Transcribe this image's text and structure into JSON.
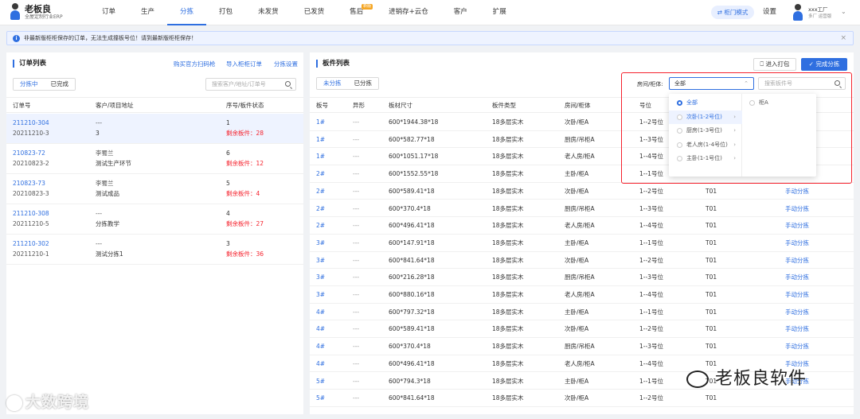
{
  "app": {
    "logo_title": "老板良",
    "logo_subtitle": "全屋定制行业ERP"
  },
  "nav": {
    "items": [
      {
        "label": "订单",
        "active": false,
        "badge": ""
      },
      {
        "label": "生产",
        "active": false,
        "badge": ""
      },
      {
        "label": "分拣",
        "active": true,
        "badge": ""
      },
      {
        "label": "打包",
        "active": false,
        "badge": ""
      },
      {
        "label": "未发货",
        "active": false,
        "badge": ""
      },
      {
        "label": "已发货",
        "active": false,
        "badge": ""
      },
      {
        "label": "售后",
        "active": false,
        "badge": "新版"
      },
      {
        "label": "进销存+云仓",
        "active": false,
        "badge": ""
      },
      {
        "label": "客户",
        "active": false,
        "badge": ""
      },
      {
        "label": "扩展",
        "active": false,
        "badge": ""
      }
    ],
    "cabinet_mode": "⇄ 柜门模式",
    "settings": "设置",
    "user_name": "xxx工厂",
    "user_role": "多厂 运营版"
  },
  "notice": {
    "text": "非最新版柜柜保存的订单，无法生成撞板号位！请到最新版柜柜保存！"
  },
  "order_panel": {
    "title": "订单列表",
    "links": [
      "购买官方扫码枪",
      "导入柜柜订单",
      "分拣设置"
    ],
    "tabs": [
      "分拣中",
      "已完成"
    ],
    "search_placeholder": "搜索客户/地址/订单号",
    "columns": [
      "订单号",
      "客户/项目地址",
      "序号/板件状态"
    ],
    "rows": [
      {
        "order_no": "211210-304",
        "order_sub": "20211210-3",
        "customer": "---",
        "address": "3",
        "seq": "1",
        "remain": "剩余板件：28",
        "selected": true
      },
      {
        "order_no": "210823-72",
        "order_sub": "20210823-2",
        "customer": "李蜀兰",
        "address": "测试生产环节",
        "seq": "6",
        "remain": "剩余板件：12",
        "selected": false
      },
      {
        "order_no": "210823-73",
        "order_sub": "20210823-3",
        "customer": "李蜀兰",
        "address": "测试成品",
        "seq": "5",
        "remain": "剩余板件：4",
        "selected": false
      },
      {
        "order_no": "211210-308",
        "order_sub": "20211210-5",
        "customer": "---",
        "address": "分拣教学",
        "seq": "4",
        "remain": "剩余板件：27",
        "selected": false
      },
      {
        "order_no": "211210-302",
        "order_sub": "20211210-1",
        "customer": "---",
        "address": "测试分拣1",
        "seq": "3",
        "remain": "剩余板件：36",
        "selected": false
      }
    ]
  },
  "board_panel": {
    "title": "板件列表",
    "enter_pack": "进入打包",
    "finish_sort": "完成分拣",
    "tabs": [
      "未分拣",
      "已分拣"
    ],
    "filter_label": "房间/柜体:",
    "filter_value": "全部",
    "search_placeholder": "搜索板件号",
    "columns": [
      "板号",
      "异形",
      "板材尺寸",
      "板件类型",
      "房间/柜体",
      "号位",
      "",
      ""
    ],
    "dropdown": {
      "col1": [
        {
          "label": "全部",
          "selected": true,
          "has_children": false
        },
        {
          "label": "次卧(1-2号位)",
          "selected": false,
          "has_children": true
        },
        {
          "label": "厨房(1-3号位)",
          "selected": false,
          "has_children": true
        },
        {
          "label": "老人房(1-4号位)",
          "selected": false,
          "has_children": true
        },
        {
          "label": "主卧(1-1号位)",
          "selected": false,
          "has_children": true
        }
      ],
      "col2": [
        {
          "label": "柜A"
        }
      ]
    },
    "rows": [
      {
        "no": "1#",
        "shape": "---",
        "size": "600*1944.38*18",
        "type": "18多层实木",
        "room": "次卧/柜A",
        "pos": "1--2号位",
        "code": "",
        "action": ""
      },
      {
        "no": "1#",
        "shape": "---",
        "size": "600*582.77*18",
        "type": "18多层实木",
        "room": "厨房/吊柜A",
        "pos": "1--3号位",
        "code": "",
        "action": ""
      },
      {
        "no": "1#",
        "shape": "---",
        "size": "600*1051.17*18",
        "type": "18多层实木",
        "room": "老人房/柜A",
        "pos": "1--4号位",
        "code": "",
        "action": ""
      },
      {
        "no": "2#",
        "shape": "---",
        "size": "600*1552.55*18",
        "type": "18多层实木",
        "room": "主卧/柜A",
        "pos": "1--1号位",
        "code": "",
        "action": ""
      },
      {
        "no": "2#",
        "shape": "---",
        "size": "600*589.41*18",
        "type": "18多层实木",
        "room": "次卧/柜A",
        "pos": "1--2号位",
        "code": "T01",
        "action": "手动分拣"
      },
      {
        "no": "2#",
        "shape": "---",
        "size": "600*370.4*18",
        "type": "18多层实木",
        "room": "厨房/吊柜A",
        "pos": "1--3号位",
        "code": "T01",
        "action": "手动分拣"
      },
      {
        "no": "2#",
        "shape": "---",
        "size": "600*496.41*18",
        "type": "18多层实木",
        "room": "老人房/柜A",
        "pos": "1--4号位",
        "code": "T01",
        "action": "手动分拣"
      },
      {
        "no": "3#",
        "shape": "---",
        "size": "600*147.91*18",
        "type": "18多层实木",
        "room": "主卧/柜A",
        "pos": "1--1号位",
        "code": "T01",
        "action": "手动分拣"
      },
      {
        "no": "3#",
        "shape": "---",
        "size": "600*841.64*18",
        "type": "18多层实木",
        "room": "次卧/柜A",
        "pos": "1--2号位",
        "code": "T01",
        "action": "手动分拣"
      },
      {
        "no": "3#",
        "shape": "---",
        "size": "600*216.28*18",
        "type": "18多层实木",
        "room": "厨房/吊柜A",
        "pos": "1--3号位",
        "code": "T01",
        "action": "手动分拣"
      },
      {
        "no": "3#",
        "shape": "---",
        "size": "600*880.16*18",
        "type": "18多层实木",
        "room": "老人房/柜A",
        "pos": "1--4号位",
        "code": "T01",
        "action": "手动分拣"
      },
      {
        "no": "4#",
        "shape": "---",
        "size": "600*797.32*18",
        "type": "18多层实木",
        "room": "主卧/柜A",
        "pos": "1--1号位",
        "code": "T01",
        "action": "手动分拣"
      },
      {
        "no": "4#",
        "shape": "---",
        "size": "600*589.41*18",
        "type": "18多层实木",
        "room": "次卧/柜A",
        "pos": "1--2号位",
        "code": "T01",
        "action": "手动分拣"
      },
      {
        "no": "4#",
        "shape": "---",
        "size": "600*370.4*18",
        "type": "18多层实木",
        "room": "厨房/吊柜A",
        "pos": "1--3号位",
        "code": "T01",
        "action": "手动分拣"
      },
      {
        "no": "4#",
        "shape": "---",
        "size": "600*496.41*18",
        "type": "18多层实木",
        "room": "老人房/柜A",
        "pos": "1--4号位",
        "code": "T01",
        "action": "手动分拣"
      },
      {
        "no": "5#",
        "shape": "---",
        "size": "600*794.3*18",
        "type": "18多层实木",
        "room": "主卧/柜A",
        "pos": "1--1号位",
        "code": "T01",
        "action": "手动分拣"
      },
      {
        "no": "5#",
        "shape": "---",
        "size": "600*841.64*18",
        "type": "18多层实木",
        "room": "次卧/柜A",
        "pos": "1--2号位",
        "code": "T01",
        "action": ""
      }
    ]
  },
  "watermarks": {
    "left": "大数跨境",
    "right": "老板良软件"
  },
  "colors": {
    "accent": "#2f6fe0",
    "danger": "#f5222d",
    "badge": "#f5a623"
  }
}
